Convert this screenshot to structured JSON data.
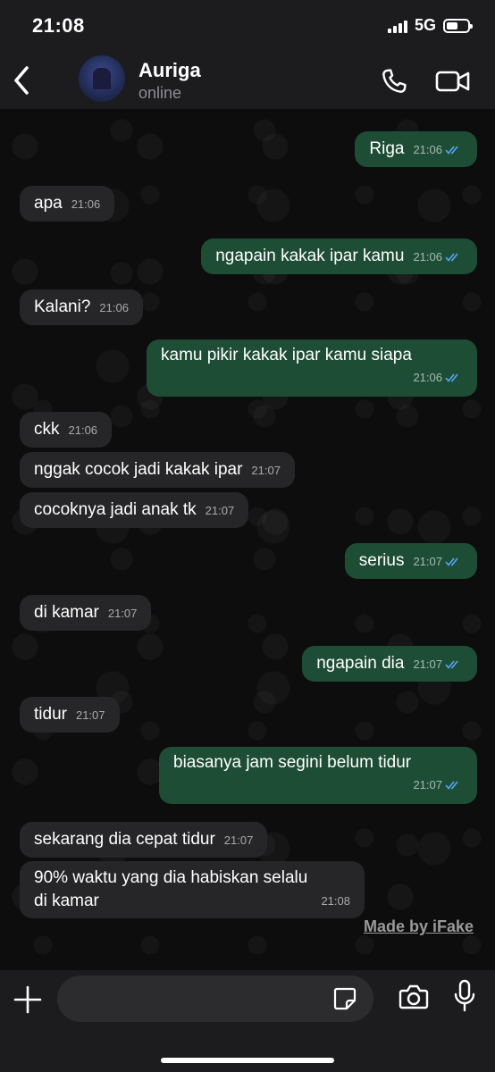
{
  "status_bar": {
    "time": "21:08",
    "network": "5G"
  },
  "header": {
    "contact_name": "Auriga",
    "contact_status": "online"
  },
  "messages": [
    {
      "dir": "out",
      "text": "Riga",
      "time": "21:06"
    },
    {
      "dir": "in",
      "text": "apa",
      "time": "21:06"
    },
    {
      "dir": "out",
      "text": "ngapain kakak ipar kamu",
      "time": "21:06"
    },
    {
      "dir": "in",
      "text": "Kalani?",
      "time": "21:06"
    },
    {
      "dir": "out",
      "text": "kamu pikir kakak ipar kamu siapa",
      "time": "21:06"
    },
    {
      "dir": "in",
      "text": "ckk",
      "time": "21:06"
    },
    {
      "dir": "in",
      "text": "nggak cocok jadi kakak ipar",
      "time": "21:07"
    },
    {
      "dir": "in",
      "text": "cocoknya jadi anak tk",
      "time": "21:07"
    },
    {
      "dir": "out",
      "text": "serius",
      "time": "21:07"
    },
    {
      "dir": "in",
      "text": "di kamar",
      "time": "21:07"
    },
    {
      "dir": "out",
      "text": "ngapain dia",
      "time": "21:07"
    },
    {
      "dir": "in",
      "text": "tidur",
      "time": "21:07"
    },
    {
      "dir": "out",
      "text": "biasanya jam segini belum tidur",
      "time": "21:07"
    },
    {
      "dir": "in",
      "text": "sekarang dia cepat tidur",
      "time": "21:07"
    },
    {
      "dir": "in",
      "text": "90% waktu yang dia habiskan selalu",
      "text2": "di kamar",
      "time": "21:08"
    }
  ],
  "watermark": "Made by iFake",
  "input": {
    "placeholder": ""
  },
  "colors": {
    "outgoing_bubble": "#1e4d35",
    "incoming_bubble": "#262628",
    "read_tick": "#53a6ff"
  },
  "icons": [
    "back-arrow-icon",
    "phone-icon",
    "video-camera-icon",
    "plus-icon",
    "sticker-icon",
    "camera-icon",
    "microphone-icon",
    "double-check-icon"
  ]
}
